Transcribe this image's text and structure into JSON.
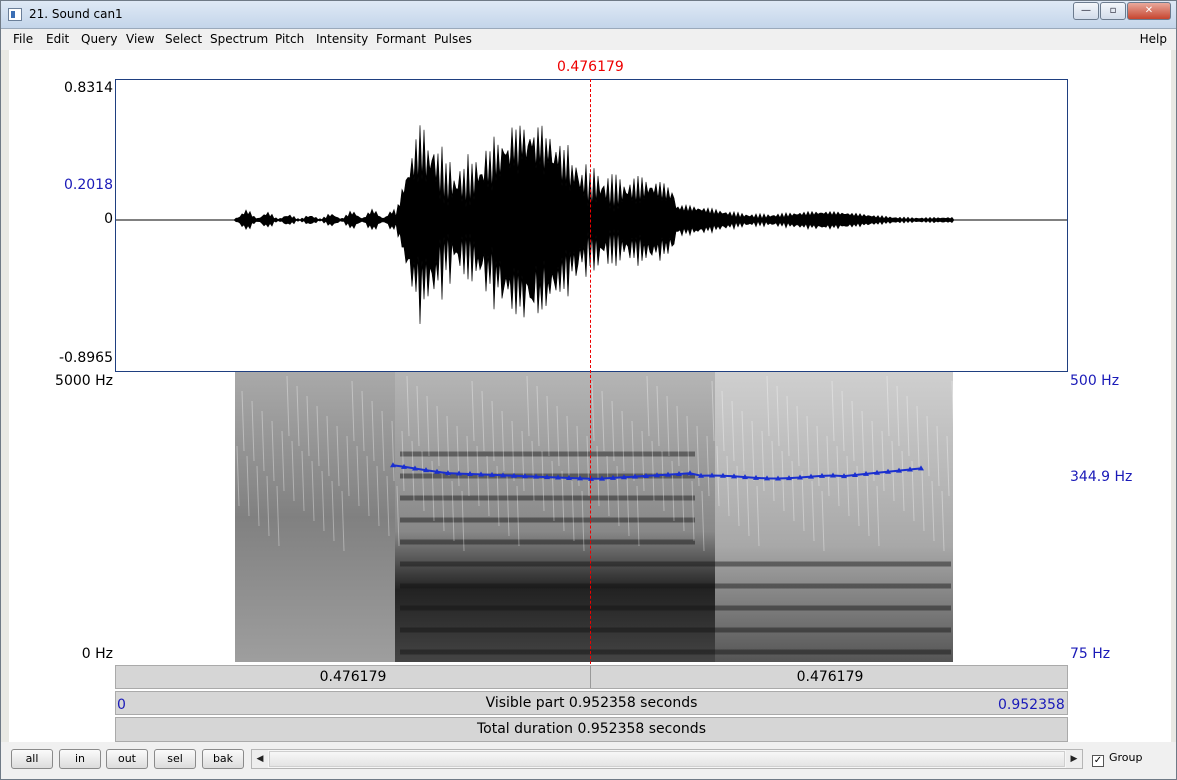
{
  "window": {
    "title": "21. Sound can1",
    "buttons": {
      "minimize": "—",
      "maximize": "▫",
      "close": "✕"
    }
  },
  "menu": {
    "items": [
      "File",
      "Edit",
      "Query",
      "View",
      "Select",
      "Spectrum",
      "Pitch",
      "Intensity",
      "Formant",
      "Pulses"
    ],
    "help": "Help"
  },
  "cursor": {
    "time": "0.476179"
  },
  "waveform": {
    "y_max": "0.8314",
    "y_cursor": "0.2018",
    "y_zero": "0",
    "y_min": "-0.8965"
  },
  "spectrogram": {
    "freq_max": "5000 Hz",
    "freq_min": "0 Hz",
    "pitch_max": "500 Hz",
    "pitch_cursor": "344.9 Hz",
    "pitch_min": "75 Hz"
  },
  "timebars": {
    "left_segment": "0.476179",
    "right_segment": "0.476179",
    "start": "0",
    "end": "0.952358",
    "visible_part": "Visible part 0.952358 seconds",
    "total_duration": "Total duration 0.952358 seconds"
  },
  "bottom": {
    "buttons": [
      "all",
      "in",
      "out",
      "sel",
      "bak"
    ],
    "group_label": "Group",
    "group_checked": "✓"
  }
}
